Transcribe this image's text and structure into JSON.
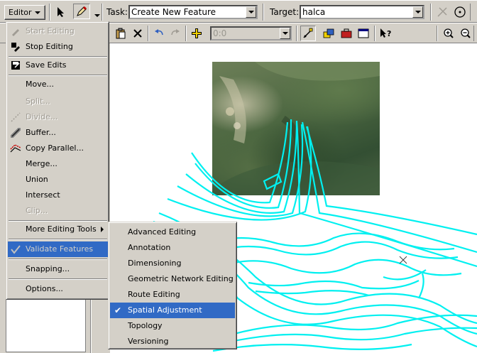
{
  "toolbar": {
    "editor_label": "Editor",
    "task_label": "Task:",
    "task_value": "Create New Feature",
    "target_label": "Target:",
    "target_value": "halca",
    "zoom_combo_value": "0:0"
  },
  "editor_menu": {
    "items": [
      {
        "label": "Start Editing",
        "icon": "start-editing-icon",
        "enabled": false
      },
      {
        "label": "Stop Editing",
        "icon": "stop-editing-icon",
        "enabled": true
      },
      {
        "label": "Save Edits",
        "icon": "save-edits-icon",
        "enabled": true
      },
      {
        "label": "Move...",
        "enabled": true
      },
      {
        "label": "Split...",
        "enabled": false
      },
      {
        "label": "Divide...",
        "icon": "divide-icon",
        "enabled": false
      },
      {
        "label": "Buffer...",
        "icon": "buffer-icon",
        "enabled": true
      },
      {
        "label": "Copy Parallel...",
        "icon": "copy-parallel-icon",
        "enabled": true
      },
      {
        "label": "Merge...",
        "enabled": true
      },
      {
        "label": "Union",
        "enabled": true
      },
      {
        "label": "Intersect",
        "enabled": true
      },
      {
        "label": "Clip...",
        "enabled": false
      },
      {
        "label": "More Editing Tools",
        "submenu": true,
        "enabled": true
      },
      {
        "label": "Validate Features",
        "icon": "validate-features-icon",
        "highlighted": true,
        "enabled": false
      },
      {
        "label": "Snapping...",
        "enabled": true
      },
      {
        "label": "Options...",
        "enabled": true
      }
    ]
  },
  "submenu": {
    "items": [
      {
        "label": "Advanced Editing"
      },
      {
        "label": "Annotation"
      },
      {
        "label": "Dimensioning"
      },
      {
        "label": "Geometric Network Editing"
      },
      {
        "label": "Route Editing"
      },
      {
        "label": "Spatial Adjustment",
        "checked": true,
        "highlighted": true
      },
      {
        "label": "Topology"
      },
      {
        "label": "Versioning"
      }
    ]
  },
  "colors": {
    "highlight": "#316ac5",
    "contours": "#00f0f0",
    "chrome": "#d4d0c8"
  }
}
